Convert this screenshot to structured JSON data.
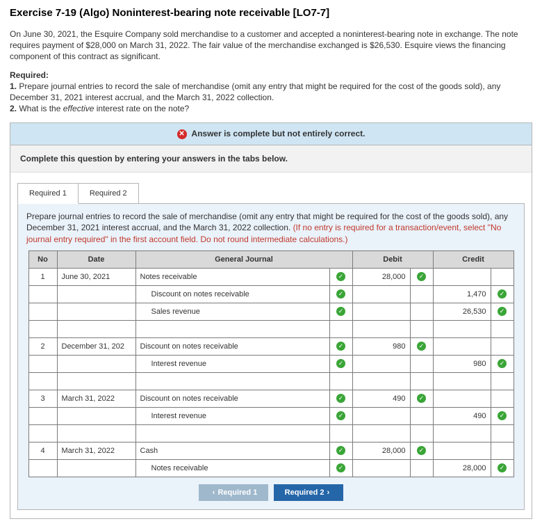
{
  "title": "Exercise 7-19 (Algo) Noninterest-bearing note receivable [LO7-7]",
  "intro": "On June 30, 2021, the Esquire Company sold merchandise to a customer and accepted a noninterest-bearing note in exchange. The note requires payment of $28,000 on March 31, 2022. The fair value of the merchandise exchanged is $26,530. Esquire views the financing component of this contract as significant.",
  "required_heading": "Required:",
  "required_1_label": "1.",
  "required_1_text": "Prepare journal entries to record the sale of merchandise (omit any entry that might be required for the cost of the goods sold), any December 31, 2021 interest accrual, and the March 31, 2022 collection.",
  "required_2_label": "2.",
  "required_2_text_a": "What is the ",
  "required_2_text_italic": "effective",
  "required_2_text_b": " interest rate on the note?",
  "status_text": "Answer is complete but not entirely correct.",
  "instruction": "Complete this question by entering your answers in the tabs below.",
  "tabs": {
    "r1": "Required 1",
    "r2": "Required 2"
  },
  "prompt_main": "Prepare journal entries to record the sale of merchandise (omit any entry that might be required for the cost of the goods sold), any December 31, 2021 interest accrual, and the March 31, 2022 collection. ",
  "prompt_red": "(If no entry is required for a transaction/event, select \"No journal entry required\" in the first account field. Do not round intermediate calculations.)",
  "headers": {
    "no": "No",
    "date": "Date",
    "gj": "General Journal",
    "debit": "Debit",
    "credit": "Credit"
  },
  "rows": [
    {
      "no": "1",
      "date": "June 30, 2021",
      "account": "Notes receivable",
      "indent": false,
      "debit": "28,000",
      "credit": ""
    },
    {
      "no": "",
      "date": "",
      "account": "Discount on notes receivable",
      "indent": true,
      "debit": "",
      "credit": "1,470"
    },
    {
      "no": "",
      "date": "",
      "account": "Sales revenue",
      "indent": true,
      "debit": "",
      "credit": "26,530"
    },
    null,
    {
      "no": "2",
      "date": "December 31, 202",
      "account": "Discount on notes receivable",
      "indent": false,
      "debit": "980",
      "credit": ""
    },
    {
      "no": "",
      "date": "",
      "account": "Interest revenue",
      "indent": true,
      "debit": "",
      "credit": "980"
    },
    null,
    {
      "no": "3",
      "date": "March 31, 2022",
      "account": "Discount on notes receivable",
      "indent": false,
      "debit": "490",
      "credit": ""
    },
    {
      "no": "",
      "date": "",
      "account": "Interest revenue",
      "indent": true,
      "debit": "",
      "credit": "490"
    },
    null,
    {
      "no": "4",
      "date": "March 31, 2022",
      "account": "Cash",
      "indent": false,
      "debit": "28,000",
      "credit": ""
    },
    {
      "no": "",
      "date": "",
      "account": "Notes receivable",
      "indent": true,
      "debit": "",
      "credit": "28,000"
    }
  ],
  "nav": {
    "prev": "Required 1",
    "next": "Required 2"
  }
}
